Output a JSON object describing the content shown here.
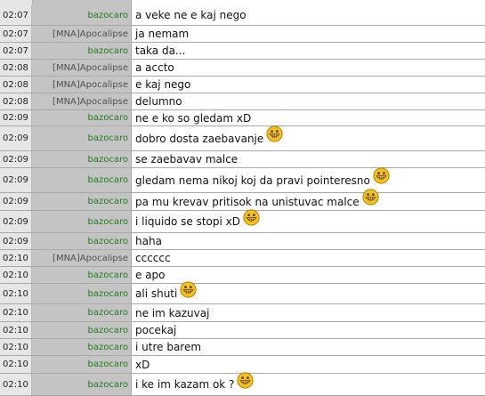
{
  "partial_top_text": "",
  "colors": {
    "time_bg": "#e6e6e6",
    "nick_bg": "#c4c4c4",
    "message_bg": "#ffffff",
    "row_border": "#a9a9a9",
    "nick_green": "#227a22",
    "nick_gray": "#505050",
    "smiley_yellow": "#f5c21b"
  },
  "messages": [
    {
      "time": "02:07",
      "nick": "bazocaro",
      "text": "a veke ne e kaj nego",
      "smiley": false
    },
    {
      "time": "02:07",
      "nick": "[MNA]Apocalipse",
      "text": "ja nemam",
      "smiley": false
    },
    {
      "time": "02:07",
      "nick": "bazocaro",
      "text": "taka da...",
      "smiley": false
    },
    {
      "time": "02:08",
      "nick": "[MNA]Apocalipse",
      "text": "a accto",
      "smiley": false
    },
    {
      "time": "02:08",
      "nick": "[MNA]Apocalipse",
      "text": "e kaj nego",
      "smiley": false
    },
    {
      "time": "02:08",
      "nick": "[MNA]Apocalipse",
      "text": "delumno",
      "smiley": false
    },
    {
      "time": "02:09",
      "nick": "bazocaro",
      "text": "ne e ko so gledam xD",
      "smiley": false
    },
    {
      "time": "02:09",
      "nick": "bazocaro",
      "text": "dobro dosta zaebavanje",
      "smiley": true
    },
    {
      "time": "02:09",
      "nick": "bazocaro",
      "text": "se zaebavav malce",
      "smiley": false
    },
    {
      "time": "02:09",
      "nick": "bazocaro",
      "text": "gledam nema nikoj koj da pravi pointeresno",
      "smiley": true
    },
    {
      "time": "02:09",
      "nick": "bazocaro",
      "text": "pa mu krevav pritisok na unistuvac malce",
      "smiley": true
    },
    {
      "time": "02:09",
      "nick": "bazocaro",
      "text": "i liquido se stopi xD",
      "smiley": true
    },
    {
      "time": "02:09",
      "nick": "bazocaro",
      "text": "haha",
      "smiley": false
    },
    {
      "time": "02:10",
      "nick": "[MNA]Apocalipse",
      "text": "cccccc",
      "smiley": false
    },
    {
      "time": "02:10",
      "nick": "bazocaro",
      "text": "e apo",
      "smiley": false
    },
    {
      "time": "02:10",
      "nick": "bazocaro",
      "text": "ali shuti",
      "smiley": true
    },
    {
      "time": "02:10",
      "nick": "bazocaro",
      "text": "ne im kazuvaj",
      "smiley": false
    },
    {
      "time": "02:10",
      "nick": "bazocaro",
      "text": "pocekaj",
      "smiley": false
    },
    {
      "time": "02:10",
      "nick": "bazocaro",
      "text": "i utre barem",
      "smiley": false
    },
    {
      "time": "02:10",
      "nick": "bazocaro",
      "text": "xD",
      "smiley": false
    },
    {
      "time": "02:10",
      "nick": "bazocaro",
      "text": "i ke im kazam ok ?",
      "smiley": true
    }
  ]
}
